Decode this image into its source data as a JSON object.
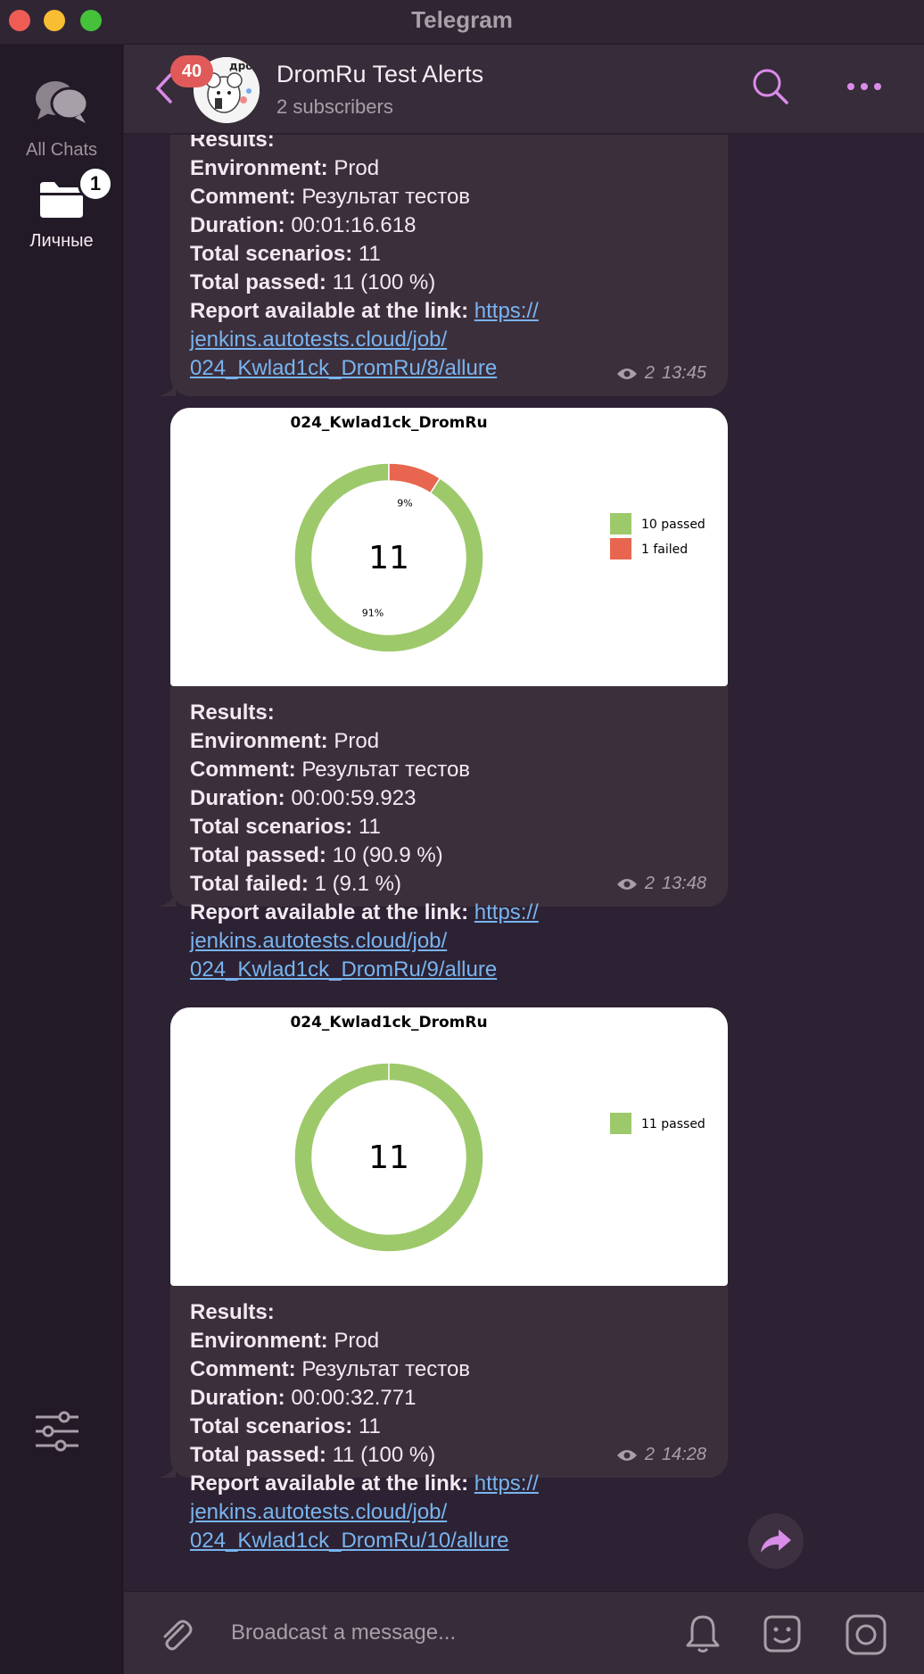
{
  "window": {
    "title": "Telegram"
  },
  "sidebar": {
    "all_chats_label": "All Chats",
    "personal_label": "Личные",
    "personal_badge": "1"
  },
  "header": {
    "unread_badge": "40",
    "channel_title": "DromRu Test Alerts",
    "channel_subtitle": "2 subscribers",
    "avatar_text": "дром"
  },
  "labels": {
    "results": "Results:",
    "environment": "Environment:",
    "comment": "Comment:",
    "duration": "Duration:",
    "total_scenarios": "Total scenarios:",
    "total_passed": "Total passed:",
    "total_failed": "Total failed:",
    "report": "Report available at the link:"
  },
  "messages": [
    {
      "environment": "Prod",
      "comment": "Результат тестов",
      "duration": "00:01:16.618",
      "total_scenarios": "11",
      "total_passed": "11 (100 %)",
      "link_line1": "https://",
      "link_line2": "jenkins.autotests.cloud/job/",
      "link_line3": "024_Kwlad1ck_DromRu/8/allure",
      "views": "2",
      "time": "13:45"
    },
    {
      "environment": "Prod",
      "comment": "Результат тестов",
      "duration": "00:00:59.923",
      "total_scenarios": "11",
      "total_passed": "10 (90.9 %)",
      "total_failed": "1 (9.1 %)",
      "link_line1": "https://",
      "link_line2": "jenkins.autotests.cloud/job/",
      "link_line3": "024_Kwlad1ck_DromRu/9/allure",
      "views": "2",
      "time": "13:48"
    },
    {
      "environment": "Prod",
      "comment": "Результат тестов",
      "duration": "00:00:32.771",
      "total_scenarios": "11",
      "total_passed": "11 (100 %)",
      "link_line1": "https://",
      "link_line2": "jenkins.autotests.cloud/job/",
      "link_line3": "024_Kwlad1ck_DromRu/10/allure",
      "views": "2",
      "time": "14:28"
    }
  ],
  "chart_data": [
    {
      "type": "pie",
      "title": "024_Kwlad1ck_DromRu",
      "center_label": "11",
      "categories": [
        "10 passed",
        "1 failed"
      ],
      "values": [
        10,
        1
      ],
      "slice_labels": [
        "91%",
        "9%"
      ],
      "colors": [
        "#9dc96b",
        "#e8664f"
      ],
      "legend": "right"
    },
    {
      "type": "pie",
      "title": "024_Kwlad1ck_DromRu",
      "center_label": "11",
      "categories": [
        "11 passed"
      ],
      "values": [
        11
      ],
      "colors": [
        "#9dc96b"
      ],
      "legend": "right"
    }
  ],
  "input": {
    "placeholder": "Broadcast a message..."
  },
  "colors": {
    "accent": "#d98ce8",
    "link": "#79b4ef",
    "passed": "#9dc96b",
    "failed": "#e8664f"
  }
}
